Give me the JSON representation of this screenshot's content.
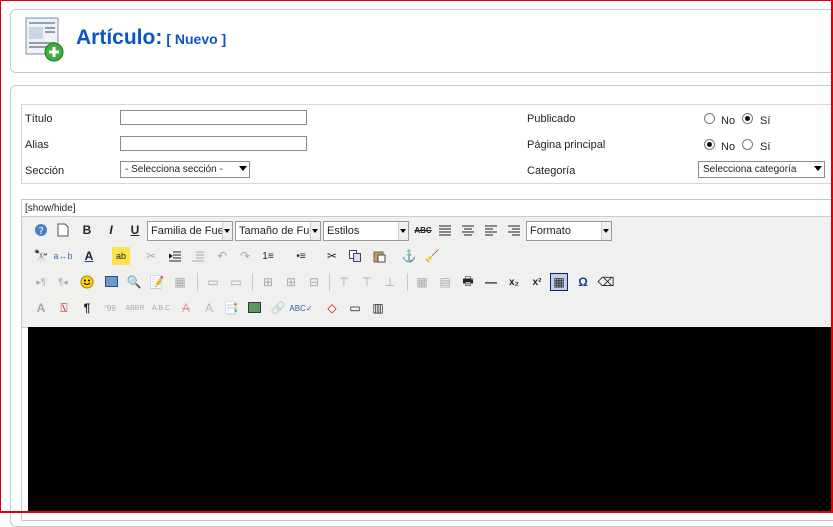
{
  "header": {
    "title": "Artículo:",
    "subtitle": "[ Nuevo ]"
  },
  "form": {
    "titulo_label": "Título",
    "alias_label": "Alias",
    "seccion_label": "Sección",
    "seccion_value": "- Selecciona sección -",
    "publicado_label": "Publicado",
    "pagina_label": "Página principal",
    "categoria_label": "Categoría",
    "categoria_value": "Selecciona categoría",
    "no": "No",
    "si": "Sí"
  },
  "editor": {
    "showhide": "[show/hide]",
    "font_family": "Familia de Fuen",
    "font_size": "Tamaño de Fue",
    "styles": "Estilos",
    "format": "Formato"
  },
  "colors": {
    "accent": "#0b55c4",
    "border": "#e00000"
  }
}
